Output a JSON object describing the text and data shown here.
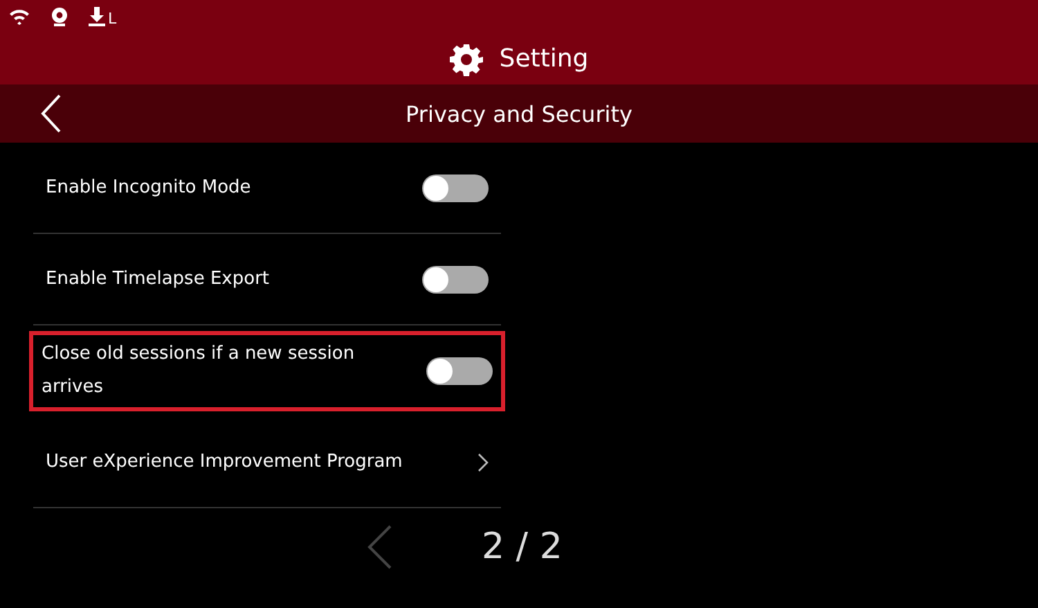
{
  "status_bar": {
    "storage_label": "L"
  },
  "header": {
    "title": "Setting"
  },
  "subheader": {
    "title": "Privacy and Security"
  },
  "settings": [
    {
      "kind": "toggle",
      "label": "Enable Incognito Mode",
      "on": false,
      "highlighted": false
    },
    {
      "kind": "toggle",
      "label": "Enable Timelapse Export",
      "on": false,
      "highlighted": false
    },
    {
      "kind": "toggle",
      "label": "Close old sessions if a new session arrives",
      "on": false,
      "highlighted": true
    },
    {
      "kind": "link",
      "label": "User eXperience Improvement Program",
      "highlighted": false
    }
  ],
  "pager": {
    "prev_disabled": true,
    "page": "2 / 2"
  }
}
